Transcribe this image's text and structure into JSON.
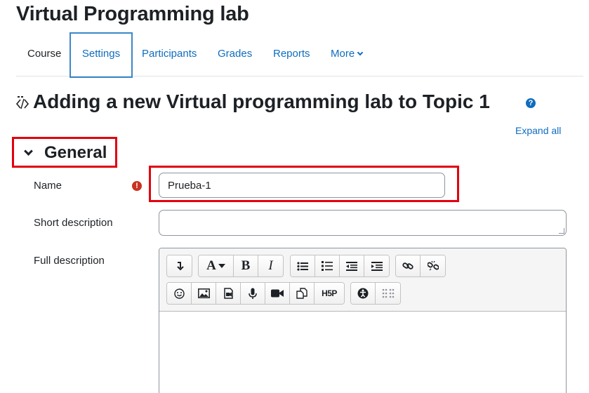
{
  "course": {
    "title": "Virtual Programming lab"
  },
  "nav": {
    "items": [
      {
        "label": "Course"
      },
      {
        "label": "Settings"
      },
      {
        "label": "Participants"
      },
      {
        "label": "Grades"
      },
      {
        "label": "Reports"
      },
      {
        "label": "More"
      }
    ]
  },
  "page": {
    "title": "Adding a new Virtual programming lab to Topic 1",
    "help_symbol": "?",
    "expand_all": "Expand all"
  },
  "section": {
    "title": "General"
  },
  "form": {
    "name": {
      "label": "Name",
      "value": "Prueba-1",
      "required_symbol": "!"
    },
    "short_description": {
      "label": "Short description",
      "value": ""
    },
    "full_description": {
      "label": "Full description",
      "value": ""
    }
  },
  "toolbar": {
    "font_label": "A",
    "bold_label": "B",
    "italic_label": "I",
    "h5p_label": "H5P",
    "icons": [
      "collapse-icon",
      "font-icon",
      "bold-icon",
      "italic-icon",
      "unordered-list-icon",
      "ordered-list-icon",
      "outdent-icon",
      "indent-icon",
      "link-icon",
      "unlink-icon",
      "emoji-icon",
      "image-icon",
      "media-icon",
      "record-audio-icon",
      "record-video-icon",
      "manage-files-icon",
      "h5p-icon",
      "accessibility-checker-icon",
      "screenreader-helper-icon"
    ]
  },
  "colors": {
    "accent": "#0f6cbf",
    "highlight": "#e3000f",
    "required": "#ca3120"
  }
}
